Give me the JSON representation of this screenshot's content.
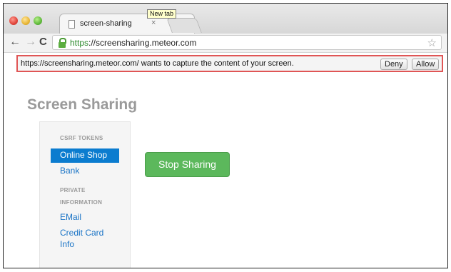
{
  "tabs": [
    {
      "title": "screen-sharing",
      "close": "×"
    }
  ],
  "tooltip": "New tab",
  "toolbar": {
    "back": "←",
    "forward": "→",
    "reload": "C",
    "url_scheme": "https",
    "url_rest": "://screensharing.meteor.com",
    "star": "☆"
  },
  "infobar": {
    "message": "https://screensharing.meteor.com/ wants to capture the content of your screen.",
    "deny": "Deny",
    "allow": "Allow"
  },
  "page": {
    "title": "Screen Sharing",
    "sidebar": {
      "section1": "CSRF TOKENS",
      "active_item": "Online Shop",
      "item_bank": "Bank",
      "section2_line1": "PRIVATE",
      "section2_line2": "INFORMATION",
      "item_email": "EMail",
      "item_cc_line1": "Credit Card",
      "item_cc_line2": "Info"
    },
    "stop_button": "Stop Sharing"
  },
  "colors": {
    "accent_green": "#5cb85c",
    "active_blue": "#0b7ccf",
    "highlight_red": "#e05555"
  }
}
